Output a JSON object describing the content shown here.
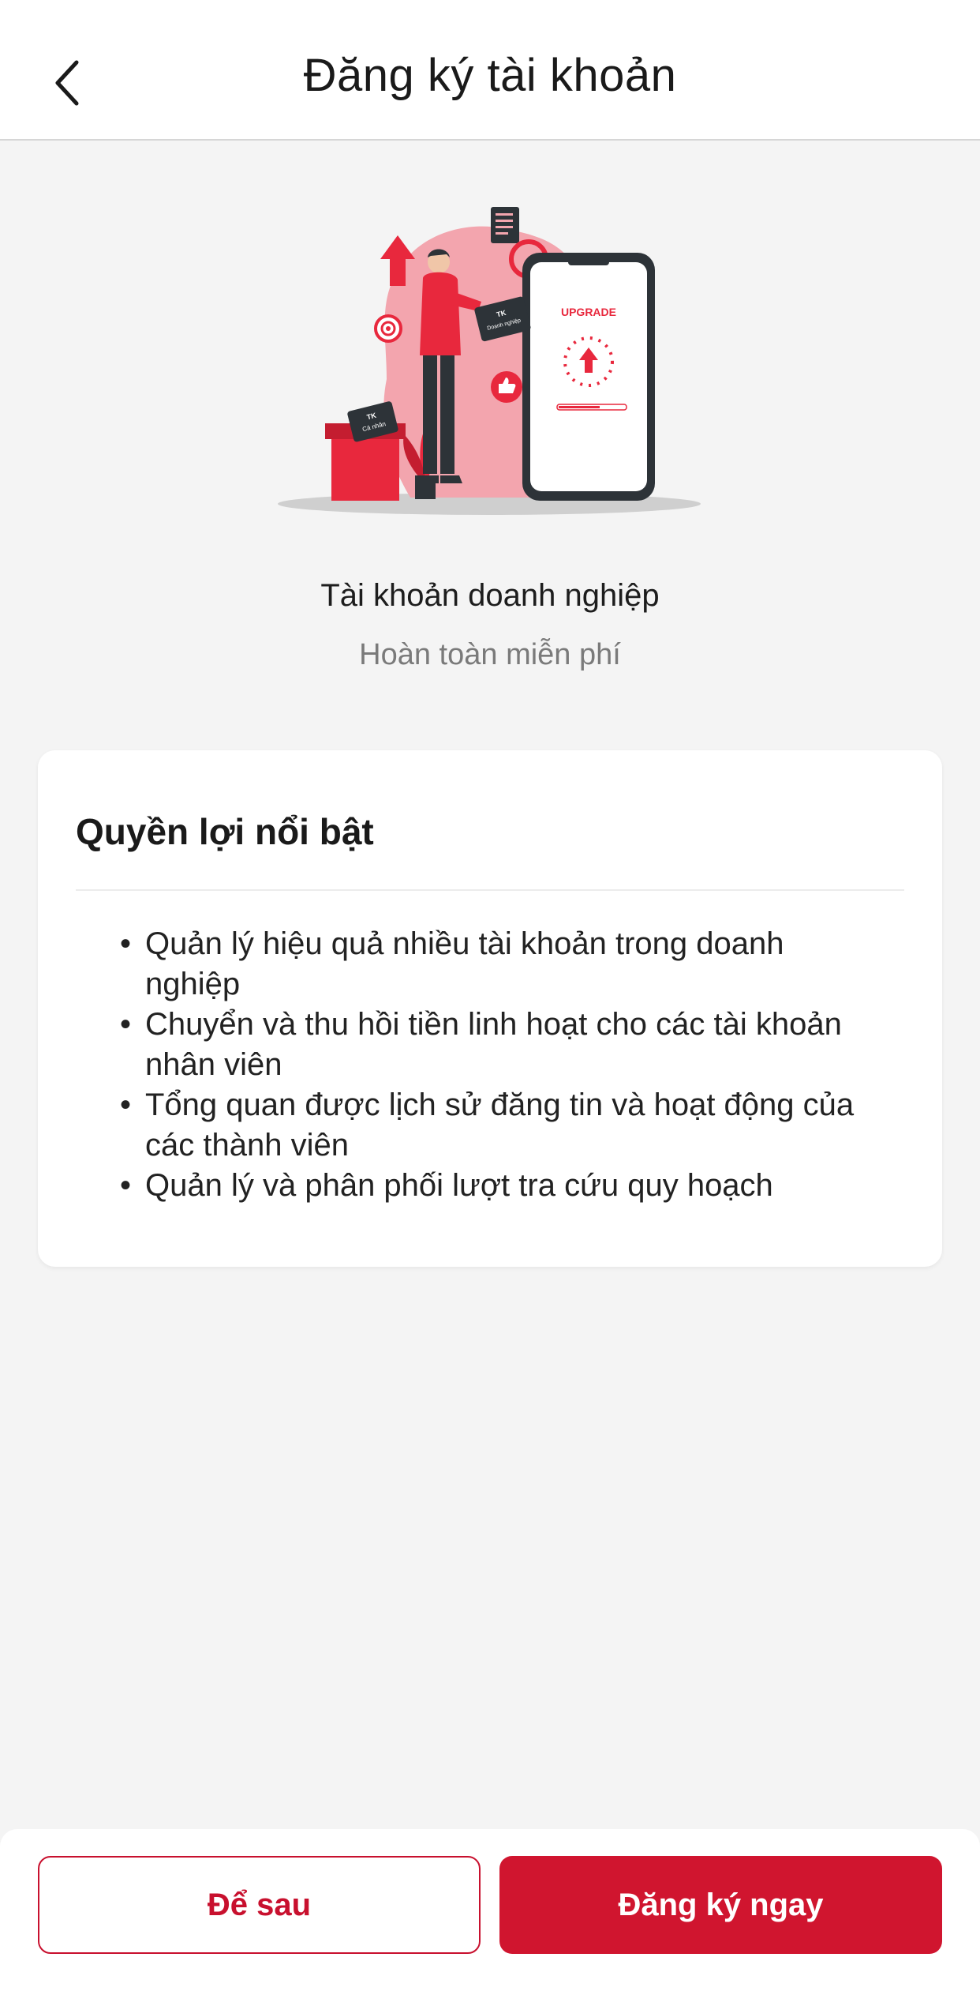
{
  "header": {
    "title": "Đăng ký tài khoản",
    "back_icon": "chevron-left-icon"
  },
  "illustration": {
    "box_front_label": "TK\nCá nhân",
    "card_label": "TK\nDoanh nghiệp",
    "phone_text": "UPGRADE",
    "accent_color": "#e8283d",
    "blob_color": "#f3a5ae"
  },
  "account": {
    "title": "Tài khoản doanh nghiệp",
    "subtitle": "Hoàn toàn miễn phí"
  },
  "benefits_card": {
    "title": "Quyền lợi nổi bật",
    "items": [
      "Quản lý hiệu quả nhiều tài khoản trong doanh nghiệp",
      "Chuyển và thu hồi tiền linh hoạt cho các tài khoản nhân viên",
      "Tổng quan được lịch sử đăng tin và hoạt động của các thành viên",
      "Quản lý và phân phối lượt tra cứu quy hoạch"
    ]
  },
  "footer": {
    "later_label": "Để sau",
    "register_label": "Đăng ký ngay"
  },
  "colors": {
    "primary": "#d0152f",
    "background": "#f4f4f4"
  }
}
